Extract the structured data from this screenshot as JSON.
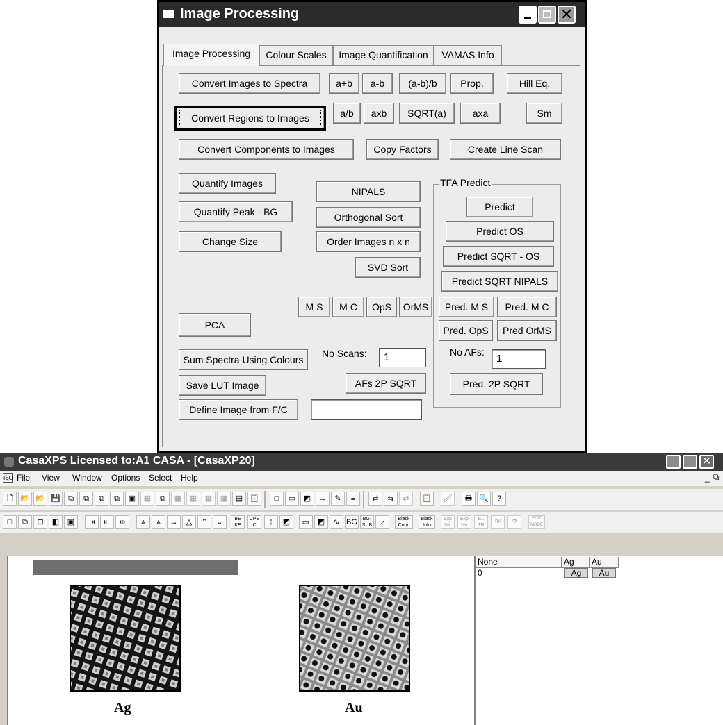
{
  "dialog": {
    "title": "Image Processing",
    "tabs": [
      "Image Processing",
      "Colour Scales",
      "Image Quantification",
      "VAMAS Info"
    ],
    "buttons": {
      "convert_images_to_spectra": "Convert Images to Spectra",
      "a_plus_b": "a+b",
      "a_minus_b": "a-b",
      "a_minus_b_over_b": "(a-b)/b",
      "prop": "Prop.",
      "hill_eq": "Hill Eq.",
      "convert_regions_to_images": "Convert Regions to Images",
      "a_over_b": "a/b",
      "a_times_b": "axb",
      "sqrt_a": "SQRT(a)",
      "a_times_a": "axa",
      "sm": "Sm",
      "convert_components_to_images": "Convert Components to Images",
      "copy_factors": "Copy Factors",
      "create_line_scan": "Create Line Scan",
      "quantify_images": "Quantify Images",
      "nipals": "NIPALS",
      "quantify_peak_bg": "Quantify Peak - BG",
      "orthogonal_sort": "Orthogonal Sort",
      "change_size": "Change Size",
      "order_images": "Order Images n x n",
      "svd_sort": "SVD Sort",
      "ms": "M S",
      "mc": "M C",
      "ops": "OpS",
      "orms": "OrMS",
      "pca": "PCA",
      "sum_spectra_using_colours": "Sum Spectra Using Colours",
      "save_lut_image": "Save LUT Image",
      "afs_2p_sqrt": "AFs 2P SQRT",
      "define_image_from_fc": "Define Image from F/C"
    },
    "no_scans_label": "No Scans:",
    "no_scans_value": "1",
    "define_image_value": "",
    "tfa": {
      "legend": "TFA Predict",
      "predict": "Predict",
      "predict_os": "Predict OS",
      "predict_sqrt_os": "Predict SQRT - OS",
      "predict_sqrt_nipals": "Predict SQRT NIPALS",
      "pred_ms": "Pred. M S",
      "pred_mc": "Pred. M C",
      "pred_ops": "Pred. OpS",
      "pred_orms": "Pred OrMS",
      "no_afs_label": "No AFs:",
      "no_afs_value": "1",
      "pred_2p_sqrt": "Pred. 2P SQRT"
    }
  },
  "main_window": {
    "title": "CasaXPS Licensed to:A1 CASA - [CasaXP20]",
    "menu": [
      "File",
      "View",
      "Window",
      "Options",
      "Select",
      "Help"
    ],
    "toolbar2_text": {
      "be_ke": "BE KE",
      "cps_c": "CPS C",
      "bg": "BG",
      "bg_sub": "BG- SUB",
      "black_conn": "Black Conn",
      "black_info": "Black Info",
      "exp_var": "Exp Var",
      "exp_var2": "Exp Var",
      "el_tr": "EL TR",
      "edit_mode": "EDIT MODE"
    },
    "images": [
      {
        "caption": "Ag"
      },
      {
        "caption": "Au"
      }
    ],
    "grid": {
      "headers": [
        "None",
        "Ag",
        "Au"
      ],
      "row_index": "0",
      "cells": [
        "Ag",
        "Au"
      ]
    }
  }
}
